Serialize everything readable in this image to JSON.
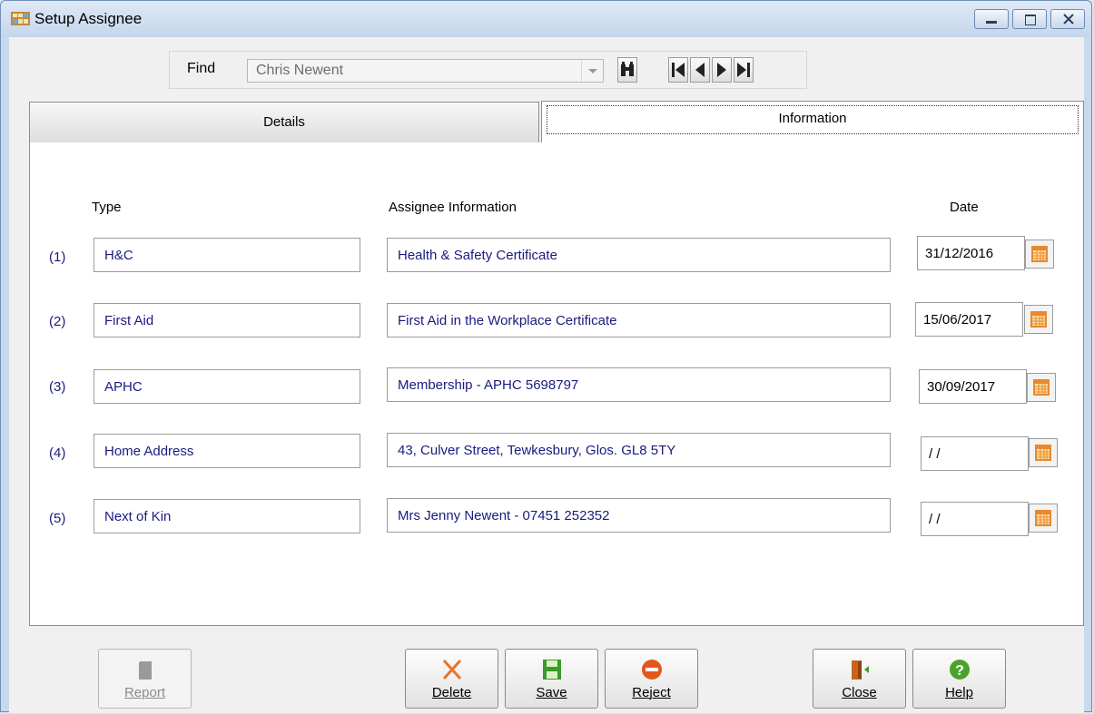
{
  "window": {
    "title": "Setup Assignee",
    "title_icon": "app-window-icon"
  },
  "find": {
    "label": "Find",
    "value": "Chris Newent"
  },
  "tabs": [
    {
      "label": "Details",
      "active": false
    },
    {
      "label": "Information",
      "active": true
    }
  ],
  "headers": {
    "type": "Type",
    "info": "Assignee Information",
    "date": "Date"
  },
  "rows": [
    {
      "num": "(1)",
      "type": "H&C",
      "info": "Health & Safety Certificate",
      "date": "31/12/2016"
    },
    {
      "num": "(2)",
      "type": "First Aid",
      "info": "First Aid in the Workplace Certificate",
      "date": "15/06/2017"
    },
    {
      "num": "(3)",
      "type": "APHC",
      "info": "Membership - APHC 5698797",
      "date": "30/09/2017"
    },
    {
      "num": "(4)",
      "type": "Home Address",
      "info": "43, Culver Street, Tewkesbury, Glos. GL8 5TY",
      "date": " / /"
    },
    {
      "num": "(5)",
      "type": "Next of Kin",
      "info": "Mrs Jenny Newent  - 07451 252352",
      "date": " / /"
    }
  ],
  "buttons": {
    "report": "Report",
    "delete": "Delete",
    "save": "Save",
    "reject": "Reject",
    "close": "Close",
    "help": "Help"
  },
  "colors": {
    "field_text": "#1a1a80",
    "title_bar": "#c4d6ec",
    "delete_icon": "#e8742a",
    "save_icon": "#3d9a2a",
    "reject_icon": "#e2571c",
    "help_icon": "#4aa328"
  }
}
